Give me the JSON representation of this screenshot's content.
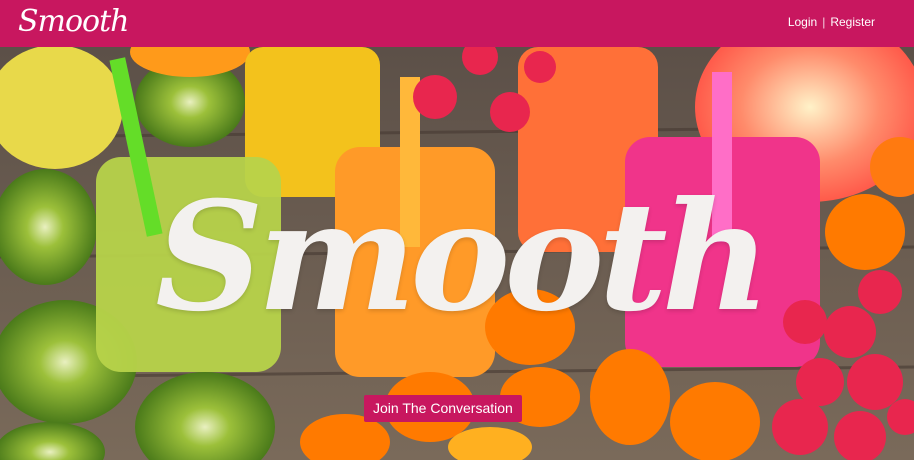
{
  "header": {
    "logo": "Smooth",
    "login_label": "Login",
    "separator": "|",
    "register_label": "Register",
    "brand_color": "#c8175f"
  },
  "hero": {
    "logo_text": "Smooth",
    "cta_label": "Join The Conversation",
    "background_image": "smoothie-jars-with-fruit-photo"
  }
}
